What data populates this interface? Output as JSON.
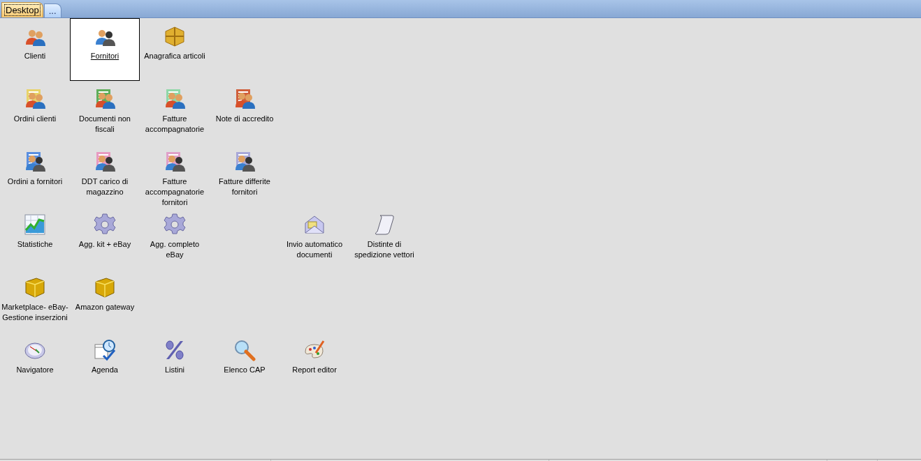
{
  "tabs": [
    {
      "label": "Desktop",
      "selected": true
    },
    {
      "label": "...",
      "selected": false
    }
  ],
  "rows": [
    [
      {
        "label": "Clienti",
        "kind": "people",
        "selected": false
      },
      {
        "label": "Fornitori",
        "kind": "suppliers",
        "selected": true
      },
      {
        "label": "Anagrafica articoli",
        "kind": "package",
        "selected": false
      }
    ],
    [
      {
        "label": "Ordini clienti",
        "kind": "document",
        "color": "#e8d36a",
        "selected": false
      },
      {
        "label": "Documenti non fiscali",
        "kind": "document",
        "color": "#5fae5a",
        "selected": false
      },
      {
        "label": "Fatture accompagnatorie",
        "kind": "document",
        "color": "#8fd8a8",
        "selected": false
      },
      {
        "label": "Note di accredito",
        "kind": "document",
        "color": "#d0603c",
        "selected": false
      }
    ],
    [
      {
        "label": "Ordini a fornitori",
        "kind": "supplier-document",
        "color": "#5a8fe0",
        "selected": false
      },
      {
        "label": "DDT carico di magazzino",
        "kind": "supplier-document",
        "color": "#e89ac0",
        "selected": false
      },
      {
        "label": "Fatture accompagnatorie fornitori",
        "kind": "supplier-document",
        "color": "#e0a0c8",
        "selected": false
      },
      {
        "label": "Fatture differite fornitori",
        "kind": "supplier-document",
        "color": "#a8a8d8",
        "selected": false
      }
    ],
    [
      {
        "label": "Statistiche",
        "kind": "chart",
        "selected": false
      },
      {
        "label": "Agg. kit + eBay",
        "kind": "gear",
        "selected": false
      },
      {
        "label": "Agg. completo eBay",
        "kind": "gear",
        "selected": false
      },
      null,
      {
        "label": "Invio automatico documenti",
        "kind": "envelope",
        "selected": false
      },
      {
        "label": "Distinte di spedizione vettori",
        "kind": "scroll",
        "selected": false
      }
    ],
    [
      {
        "label": "Marketplace- eBay- Gestione inserzioni",
        "kind": "cube",
        "selected": false
      },
      {
        "label": "Amazon gateway",
        "kind": "cube",
        "selected": false
      }
    ],
    [
      {
        "label": "Navigatore",
        "kind": "compass",
        "selected": false
      },
      {
        "label": "Agenda",
        "kind": "calendar",
        "selected": false
      },
      {
        "label": "Listini",
        "kind": "percent",
        "selected": false
      },
      {
        "label": "Elenco CAP",
        "kind": "magnifier",
        "selected": false
      },
      {
        "label": "Report editor",
        "kind": "palette",
        "selected": false
      }
    ]
  ]
}
